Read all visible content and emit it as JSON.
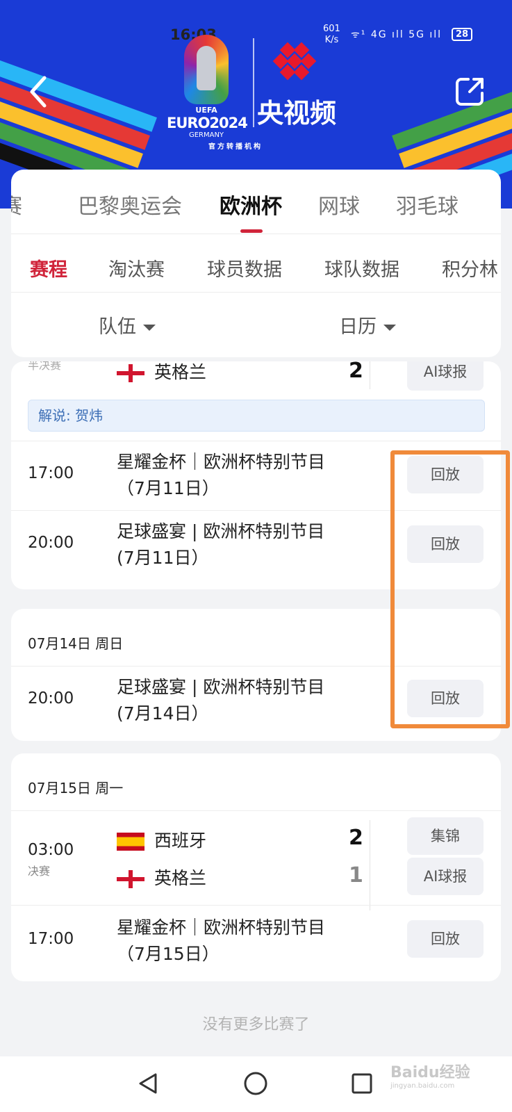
{
  "status_bar": {
    "time": "16:03",
    "speed_value": "601",
    "speed_unit": "K/s",
    "network_icons": "ᯤ¹ 4G ıll 5G ıll",
    "battery": "28"
  },
  "header": {
    "logo_uefa": "UEFA",
    "logo_euro": "EURO2024",
    "logo_germany": "GERMANY",
    "broadcaster_name": "央视频",
    "broadcaster_tag": "官方转播机构"
  },
  "main_tabs": [
    "比赛",
    "巴黎奥运会",
    "欧洲杯",
    "网球",
    "羽毛球"
  ],
  "main_tab_visible_partial": "赛",
  "sub_tabs": [
    "赛程",
    "淘汰赛",
    "球员数据",
    "球队数据",
    "积分榜"
  ],
  "sub_tab_partial": "积分林",
  "filters": {
    "team": "队伍",
    "calendar": "日历"
  },
  "card1": {
    "partial_stage": "半决赛",
    "partial_team": "英格兰",
    "partial_score": "2",
    "partial_button": "AI球报",
    "commentary": "解说: 贺炜",
    "rows": [
      {
        "time": "17:00",
        "line1": "星耀金杯｜欧洲杯特别节目",
        "line2": "（7月11日）",
        "button": "回放"
      },
      {
        "time": "20:00",
        "line1": "足球盛宴 | 欧洲杯特别节目",
        "line2": "(7月11日）",
        "button": "回放"
      }
    ]
  },
  "card2": {
    "date": "07月14日 周日",
    "rows": [
      {
        "time": "20:00",
        "line1": "足球盛宴 | 欧洲杯特别节目",
        "line2": "(7月14日）",
        "button": "回放"
      }
    ]
  },
  "card3": {
    "date": "07月15日 周一",
    "match": {
      "time": "03:00",
      "stage": "决赛",
      "team1": "西班牙",
      "score1": "2",
      "team2": "英格兰",
      "score2": "1",
      "button1": "集锦",
      "button2": "AI球报"
    },
    "rows": [
      {
        "time": "17:00",
        "line1": "星耀金杯｜欧洲杯特别节目",
        "line2": "（7月15日）",
        "button": "回放"
      }
    ]
  },
  "footer_text": "没有更多比赛了",
  "watermark": {
    "text": "Baidu经验",
    "sub": "jingyan.baidu.com"
  },
  "colors": {
    "banner": "#1a3bd6",
    "accent_red": "#d0243a",
    "highlight_orange": "#f08a3a"
  },
  "icons": {
    "back": "chevron-left-icon",
    "share": "share-icon",
    "nav_back": "triangle-back-icon",
    "nav_home": "circle-home-icon",
    "nav_recent": "square-recent-icon"
  }
}
